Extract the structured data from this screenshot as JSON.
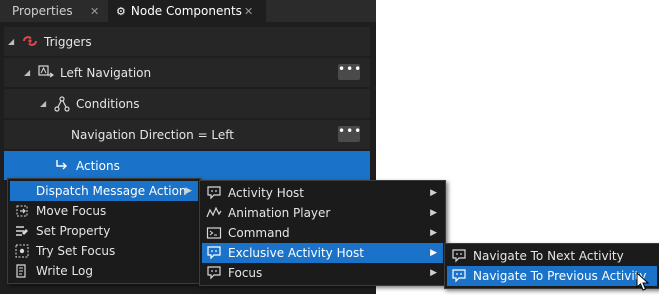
{
  "tabs": {
    "properties": "Properties",
    "node_components": "Node Components",
    "close_glyph": "✕"
  },
  "tree": {
    "triggers": "Triggers",
    "left_navigation": "Left Navigation",
    "conditions": "Conditions",
    "condition_expr": "Navigation Direction = Left",
    "actions": "Actions",
    "more": "•••"
  },
  "menu1": {
    "items": [
      "Dispatch Message Action",
      "Move Focus",
      "Set Property",
      "Try Set Focus",
      "Write Log"
    ]
  },
  "menu2": {
    "items": [
      "Activity Host",
      "Animation Player",
      "Command",
      "Exclusive Activity Host",
      "Focus"
    ]
  },
  "menu3": {
    "items": [
      "Navigate To Next Activity",
      "Navigate To Previous Activity"
    ]
  },
  "colors": {
    "selection": "#1a73c8",
    "panel": "#1e1e1e",
    "trigger_icon": "#e0464f"
  }
}
